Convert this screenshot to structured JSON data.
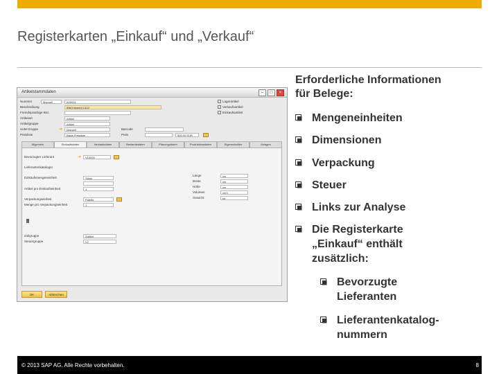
{
  "slide": {
    "title": "Registerkarten „Einkauf“ und „Verkauf“",
    "info_title_line1": "Erforderliche Informationen",
    "info_title_line2": "für Belege:",
    "bullets": [
      "Mengeneinheiten",
      "Dimensionen",
      "Verpackung",
      "Steuer",
      "Links zur Analyse"
    ],
    "bullet_last_line1": "Die Registerkarte",
    "bullet_last_line2": "„Einkauf“ enthält",
    "bullet_last_line3": "zusätzlich:",
    "sub_bullet1_line1": "Bevorzugte",
    "sub_bullet1_line2": "Lieferanten",
    "sub_bullet2_line1": "Lieferantenkatalog-",
    "sub_bullet2_line2": "nummern",
    "copyright": "© 2013 SAP AG. Alle Rechte vorbehalten.",
    "page_number": "8"
  },
  "colors": {
    "accent": "#f0ab00",
    "footer": "#000000"
  },
  "window": {
    "title": "Artikelstammdaten",
    "left_labels": [
      "Nummer",
      "Beschreibung",
      "Fremdsprachige Bez.",
      "Artikelart",
      "Artikelgruppe",
      "UoM-Gruppe",
      "Preisliste"
    ],
    "left_values": [
      "Manuell",
      "A00001",
      "IBM Infoprint 1312",
      "Artikel",
      "Artikel",
      "Manuell",
      "Basis Preisliste"
    ],
    "middle_labels": [
      "Barcode",
      "Preis"
    ],
    "middle_values": [
      "",
      "500,00 EUR"
    ],
    "checkboxes": [
      "Lagerartikel",
      "Verkaufsartikel",
      "Einkaufsartikel"
    ],
    "tabs": [
      "Allgemein",
      "Einkaufsdaten",
      "Verkaufsdaten",
      "Bestandsdaten",
      "Planungsdaten",
      "Produktionsdaten",
      "Eigenschaften",
      "Anlagen"
    ],
    "panel_labels": [
      "Bevorzugter Lieferant",
      "Lieferantenkatalognr.",
      "Einkaufsmengeneinheit",
      "Artikel pro Einkaufseinheit",
      "Verpackungseinheit",
      "Menge pro Verpackungseinheit"
    ],
    "panel_values": [
      "V10000",
      "",
      "Stück",
      "1",
      "Palette",
      "1"
    ],
    "dim_labels": [
      "Länge",
      "Breite",
      "Höhe",
      "Volumen",
      "Gewicht"
    ],
    "dim_values": [
      "cm",
      "cm",
      "cm",
      "cm3",
      "kg"
    ],
    "bottom_labels": [
      "Zollgruppe",
      "Steuergruppe"
    ],
    "bottom_values": [
      "Zollfrei",
      "V2"
    ],
    "ok_button": "OK",
    "cancel_button": "Abbrechen"
  }
}
